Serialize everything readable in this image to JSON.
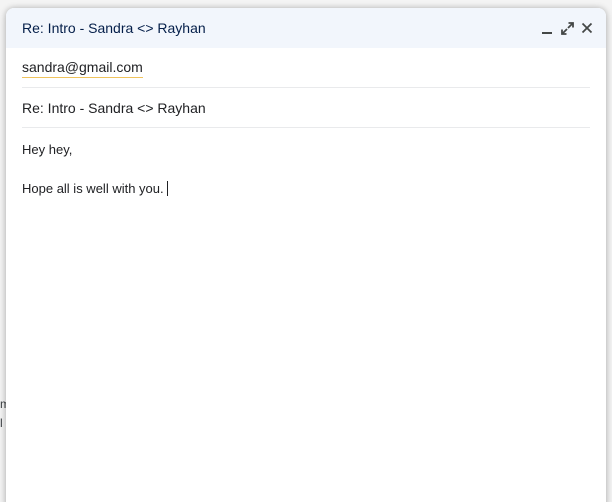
{
  "background": {
    "fragments": [
      "m",
      "l"
    ]
  },
  "compose": {
    "title": "Re: Intro - Sandra <> Rayhan",
    "controls": {
      "minimize_icon": "minimize-icon",
      "expand_icon": "expand-icon",
      "close_icon": "close-icon"
    },
    "to": {
      "recipient": "sandra@gmail.com"
    },
    "subject": "Re: Intro - Sandra <> Rayhan",
    "body": {
      "lines": [
        "Hey hey,",
        "",
        "Hope all is well with you."
      ]
    }
  },
  "colors": {
    "header_bg": "#f2f6fc",
    "title_text": "#041e49",
    "chip_underline": "#f0c35c"
  }
}
